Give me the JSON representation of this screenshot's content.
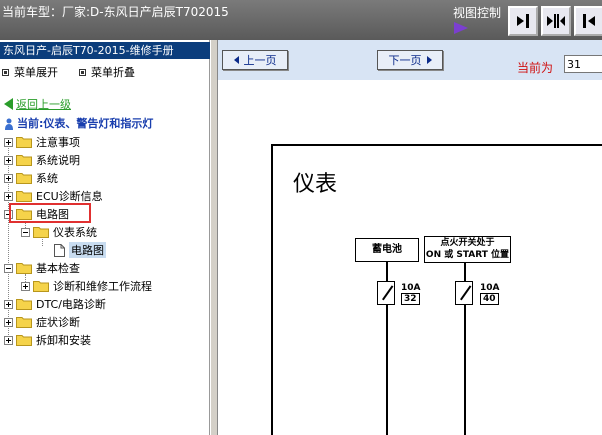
{
  "header": {
    "title": "当前车型：厂家:D-东风日产启辰T702015",
    "view_control": "视图控制",
    "buttons": [
      "collapse-left-icon",
      "split-view-icon",
      "collapse-right-icon"
    ]
  },
  "sidebar": {
    "manual_title": "东风日产-启辰T70-2015-维修手册",
    "expand_all": "菜单展开",
    "collapse_all": "菜单折叠",
    "back_link": "返回上一级",
    "current": "当前:仪表、警告灯和指示灯",
    "tree": [
      {
        "label": "注意事项"
      },
      {
        "label": "系统说明"
      },
      {
        "label": "系统"
      },
      {
        "label": "ECU诊断信息"
      },
      {
        "label": "电路图"
      },
      {
        "label": "仪表系统"
      },
      {
        "label": "电路图"
      },
      {
        "label": "基本检查"
      },
      {
        "label": "诊断和维修工作流程"
      },
      {
        "label": "DTC/电路诊断"
      },
      {
        "label": "症状诊断"
      },
      {
        "label": "拆卸和安装"
      }
    ]
  },
  "nav": {
    "prev": "上一页",
    "next": "下一页",
    "current_label": "当前为",
    "page_value": "31"
  },
  "diagram": {
    "title": "仪表",
    "battery_label": "蓄电池",
    "ignition_label_1": "点火开关处于",
    "ignition_label_2": "ON 或 START 位置",
    "fuse1_amp": "10A",
    "fuse1_num": "32",
    "fuse2_amp": "10A",
    "fuse2_num": "40"
  },
  "colors": {
    "manual_title_bg": "#0b3d7c",
    "current_text": "#1a3fae",
    "back_link": "#2a9d2a",
    "highlight": "#e03030",
    "cur_label": "#d01010"
  }
}
